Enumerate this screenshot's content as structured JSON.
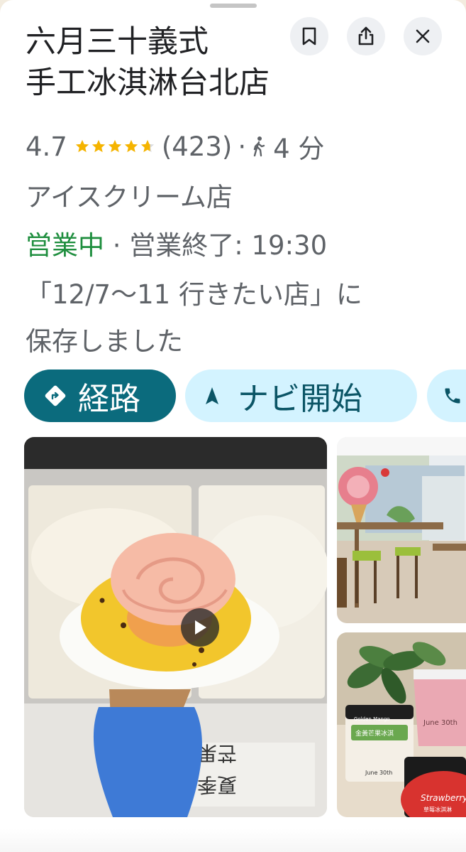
{
  "place": {
    "name_line1": "六月三十義式",
    "name_line2": "手工冰淇淋台北店",
    "rating": "4.7",
    "stars": 4.7,
    "review_count": "(423)",
    "separator": "·",
    "walk_time": "4 分",
    "category": "アイスクリーム店",
    "open_status": "営業中",
    "hours_text": " · 営業終了: 19:30",
    "saved_line1": "「12/7～11 行きたい店」に",
    "saved_line2": "保存しました"
  },
  "header_buttons": {
    "save_icon": "bookmark-icon",
    "share_icon": "share-icon",
    "close_icon": "close-icon"
  },
  "actions": {
    "directions_label": "経路",
    "start_label": "ナビ開始",
    "call_icon": "phone-icon"
  },
  "photos": {
    "main_signs": [
      "夏季",
      "芒果"
    ],
    "jar_labels": {
      "jar1_brand": "Golden Mango",
      "jar1_cn": "金黃芒果冰淇",
      "jar2_brand": "June 30th",
      "jar3_text": "Strawberry",
      "jar3_cn": "草莓冰淇淋",
      "cup_text": "June 30th"
    }
  },
  "colors": {
    "accent": "#0b6b7d",
    "chip_secondary_bg": "#d3f3ff",
    "open_green": "#1e8e3e",
    "star_gold": "#f5b400",
    "text_secondary": "#5f6368"
  }
}
